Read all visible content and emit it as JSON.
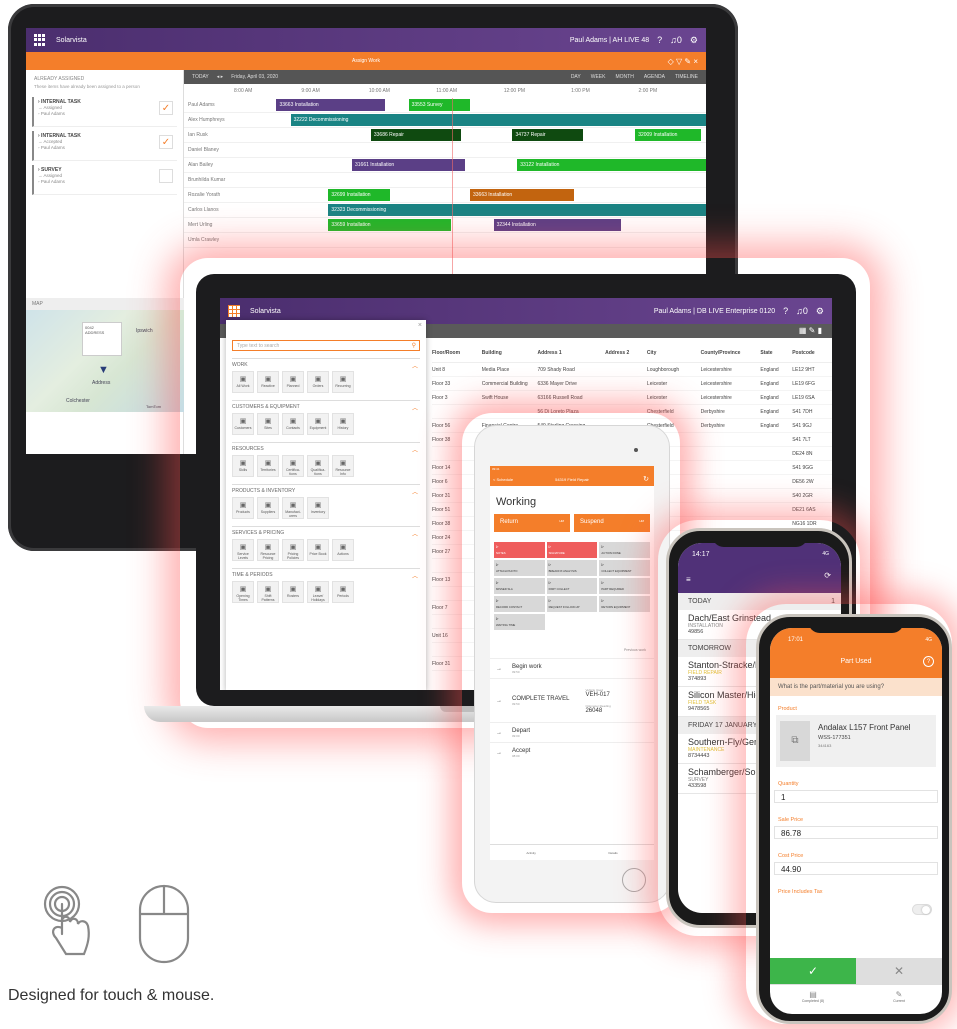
{
  "monitor": {
    "app_name": "Solarvista",
    "user": "Paul Adams | AH LIVE 48",
    "icons": [
      "help-icon",
      "bell-icon",
      "gear-icon"
    ],
    "notif_count": "0",
    "orange_title": "Assign Work",
    "left": {
      "title": "ALREADY ASSIGNED",
      "subtitle": "These items have already been assigned to a person",
      "tasks": [
        {
          "name": "INTERNAL TASK",
          "status": "Assigned",
          "person": "Paul Adams",
          "checked": true
        },
        {
          "name": "INTERNAL TASK",
          "status": "Accepted",
          "person": "Paul Adams",
          "checked": true
        },
        {
          "name": "SURVEY",
          "status": "Assigned",
          "person": "Paul Adams",
          "checked": false
        }
      ],
      "map_label": "MAP",
      "map_popup": [
        "0042",
        "ADDRESS"
      ],
      "map_places": [
        "Ipswich",
        "Address",
        "Colchester"
      ],
      "map_credit": "TomTom"
    },
    "calendar": {
      "today": "TODAY",
      "date": "Friday, April 03, 2020",
      "views": [
        "DAY",
        "WEEK",
        "MONTH",
        "AGENDA",
        "TIMELINE"
      ],
      "times": [
        "8:00 AM",
        "9:00 AM",
        "10:00 AM",
        "11:00 AM",
        "12:00 PM",
        "1:00 PM",
        "2:00 PM"
      ],
      "rows": [
        {
          "name": "Paul Adams",
          "bars": [
            {
              "label": "33663 Installation",
              "c": "purple",
              "s": 0.09,
              "w": 0.23
            },
            {
              "label": "33553 Survey",
              "c": "green",
              "s": 0.37,
              "w": 0.13
            }
          ]
        },
        {
          "name": "Alex Humphreys",
          "bars": [
            {
              "label": "32222 Decommissioning",
              "c": "teal",
              "s": 0.12,
              "w": 0.88
            }
          ]
        },
        {
          "name": "Ian Rusk",
          "bars": [
            {
              "label": "33686 Repair",
              "c": "dkgreen",
              "s": 0.29,
              "w": 0.19
            },
            {
              "label": "34737 Repair",
              "c": "dkgreen",
              "s": 0.59,
              "w": 0.15
            },
            {
              "label": "32009 Installation",
              "c": "green",
              "s": 0.85,
              "w": 0.14
            }
          ]
        },
        {
          "name": "Daniel Blaney",
          "bars": []
        },
        {
          "name": "Alan Bailey",
          "bars": [
            {
              "label": "31661 Installation",
              "c": "purple",
              "s": 0.25,
              "w": 0.24
            },
            {
              "label": "33122 Installation",
              "c": "green",
              "s": 0.6,
              "w": 0.4
            }
          ]
        },
        {
          "name": "Brunhilda Kumar",
          "bars": []
        },
        {
          "name": "Rozalie Yorath",
          "bars": [
            {
              "label": "32699 Installation",
              "c": "green",
              "s": 0.2,
              "w": 0.13
            },
            {
              "label": "33663 Installation",
              "c": "orange",
              "s": 0.5,
              "w": 0.22
            }
          ]
        },
        {
          "name": "Carlos Llanos",
          "bars": [
            {
              "label": "32323 Decommissioning",
              "c": "teal",
              "s": 0.2,
              "w": 0.8
            }
          ]
        },
        {
          "name": "Mert Urling",
          "bars": [
            {
              "label": "33659 Installation",
              "c": "green",
              "s": 0.2,
              "w": 0.26
            },
            {
              "label": "32344 Installation",
              "c": "purple",
              "s": 0.55,
              "w": 0.27
            }
          ]
        },
        {
          "name": "Umla Crawley",
          "bars": []
        }
      ]
    }
  },
  "laptop": {
    "app_name": "Solarvista",
    "user": "Paul Adams | DB LIVE Enterprise 0120",
    "search_placeholder": "Type text to search",
    "sections": [
      {
        "title": "WORK",
        "tiles": [
          [
            "All Work",
            "clipboard-icon"
          ],
          [
            "Reactive",
            "wrench-icon"
          ],
          [
            "Planned",
            "bell-icon"
          ],
          [
            "Orders",
            "org-icon"
          ],
          [
            "Recurring",
            "shield-icon"
          ]
        ]
      },
      {
        "title": "CUSTOMERS & EQUIPMENT",
        "tiles": [
          [
            "Customers",
            "building-icon"
          ],
          [
            "Sites",
            "globe-icon"
          ],
          [
            "Contacts",
            "people-icon"
          ],
          [
            "Equipment",
            "doc-icon"
          ],
          [
            "History",
            "history-icon"
          ]
        ]
      },
      {
        "title": "RESOURCES",
        "tiles": [
          [
            "Skills",
            "person-icon"
          ],
          [
            "Territories",
            "map-icon"
          ],
          [
            "Certifica-tions",
            "cert-icon"
          ],
          [
            "Qualifica-tions",
            "qual-icon"
          ],
          [
            "Resource Info",
            "card-icon"
          ]
        ]
      },
      {
        "title": "PRODUCTS & INVENTORY",
        "tiles": [
          [
            "Products",
            "box-icon"
          ],
          [
            "Suppliers",
            "cart-icon"
          ],
          [
            "Manufact-urers",
            "factory-icon"
          ],
          [
            "Inventory",
            "list-icon"
          ]
        ]
      },
      {
        "title": "SERVICES & PRICING",
        "tiles": [
          [
            "Service Levels",
            "timer-icon"
          ],
          [
            "Resource Pricing",
            "price-icon"
          ],
          [
            "Pricing Policies",
            "policy-icon"
          ],
          [
            "Price Book",
            "tag-icon"
          ],
          [
            "Actions",
            "hand-icon"
          ]
        ]
      },
      {
        "title": "TIME & PERIODS",
        "tiles": [
          [
            "Opening Times",
            "shop-icon"
          ],
          [
            "Shift Patterns",
            "clock-icon"
          ],
          [
            "Rosters",
            "bed-icon"
          ],
          [
            "Leave/ Holidays",
            "plane-icon"
          ],
          [
            "Periods",
            "calendar-icon"
          ]
        ]
      }
    ],
    "table": {
      "headers": [
        "Floor/Room",
        "Building",
        "Address 1",
        "Address 2",
        "City",
        "County/Province",
        "State",
        "Postcode"
      ],
      "rows": [
        [
          "Unit 8",
          "Media Place",
          "709 Shady Road",
          "",
          "Loughborough",
          "Leicestershire",
          "England",
          "LE12 9HT"
        ],
        [
          "Floor 33",
          "Commercial Building",
          "6336 Mayer Drive",
          "",
          "Leicester",
          "Leicestershire",
          "England",
          "LE19 6FG"
        ],
        [
          "Floor 3",
          "Swift House",
          "63166 Russell Road",
          "",
          "Leicester",
          "Leicestershire",
          "England",
          "LE19 6SA"
        ],
        [
          "",
          "",
          "56 Di Loreto Plaza",
          "",
          "Chesterfield",
          "Derbyshire",
          "England",
          "S41 7DH"
        ],
        [
          "Floor 56",
          "Financial Centre",
          "549 Sterling Crossing",
          "",
          "Chesterfield",
          "Derbyshire",
          "England",
          "S41 9GJ"
        ],
        [
          "Floor 38",
          "",
          "",
          "",
          "",
          "",
          "",
          "S41 7LT"
        ],
        [
          "",
          "",
          "",
          "",
          "",
          "",
          "",
          "DE24 8N"
        ],
        [
          "Floor 14",
          "",
          "",
          "",
          "",
          "",
          "",
          "S41 9GG"
        ],
        [
          "Floor 6",
          "",
          "",
          "",
          "",
          "",
          "",
          "DE56 2W"
        ],
        [
          "Floor 31",
          "",
          "",
          "",
          "",
          "",
          "",
          "S40 2GR"
        ],
        [
          "Floor 51",
          "",
          "",
          "",
          "",
          "",
          "",
          "DE21 6AS"
        ],
        [
          "Floor 38",
          "",
          "",
          "",
          "",
          "",
          "",
          "NG16 1DR"
        ],
        [
          "Floor 24",
          "",
          "",
          "",
          "",
          "",
          "",
          "NG16 7TA"
        ],
        [
          "Floor 27",
          "",
          "",
          "",
          "",
          "",
          "",
          ""
        ],
        [
          "",
          "",
          "",
          "",
          "",
          "",
          "",
          ""
        ],
        [
          "Floor 13",
          "",
          "",
          "",
          "",
          "",
          "",
          ""
        ],
        [
          "",
          "",
          "",
          "",
          "",
          "",
          "",
          ""
        ],
        [
          "Floor 7",
          "",
          "",
          "",
          "",
          "",
          "",
          ""
        ],
        [
          "",
          "",
          "",
          "",
          "",
          "",
          "",
          ""
        ],
        [
          "Unit 16",
          "",
          "",
          "",
          "",
          "",
          "",
          ""
        ],
        [
          "",
          "",
          "",
          "",
          "",
          "",
          "",
          ""
        ],
        [
          "Floor 31",
          "",
          "",
          "",
          "",
          "",
          "",
          ""
        ]
      ]
    }
  },
  "tablet": {
    "status_time": "09:41",
    "back": "< Schedule",
    "header": "54319 Field Repair",
    "title": "Working",
    "buttons": [
      {
        "label": "Return",
        "sub": "HM"
      },
      {
        "label": "Suspend",
        "sub": "HM"
      }
    ],
    "actions": [
      {
        "label": "NOTES",
        "red": true
      },
      {
        "label": "SIGNATURE",
        "red": true
      },
      {
        "label": "ACTION DONE",
        "red": false
      },
      {
        "label": "ATTACH PHOTO",
        "red": false
      },
      {
        "label": "BREAKFIX ANALYSIS",
        "red": false
      },
      {
        "label": "COLLECT EQUIPMENT",
        "red": false
      },
      {
        "label": "MISSED SLA",
        "red": false
      },
      {
        "label": "PART COLLECT",
        "red": false
      },
      {
        "label": "PART REQUIRED",
        "red": false
      },
      {
        "label": "RECORD CONTACT",
        "red": false
      },
      {
        "label": "REQUEST FOLLOW-UP",
        "red": false
      },
      {
        "label": "RETURN EQUIPMENT",
        "red": false
      },
      {
        "label": "WAITING TIME",
        "red": false
      }
    ],
    "previous": "Previous work",
    "timeline": [
      {
        "label": "Begin work",
        "time": "09:50"
      },
      {
        "label": "COMPLETE TRAVEL",
        "time": "09:50",
        "vehicle_label": "Vehicle Used",
        "vehicle": "VEH-017",
        "odo_label": "Odometer Reading",
        "odo": "26048"
      },
      {
        "label": "Depart",
        "time": "09:00"
      },
      {
        "label": "Accept",
        "time": "08:00"
      }
    ],
    "tabs": [
      "Activity",
      "Details"
    ]
  },
  "phone1": {
    "time": "14:17",
    "status": "4G",
    "today": "TODAY",
    "today_count": "1",
    "tomorrow": "TOMORROW",
    "friday": "FRIDAY 17 JANUARY",
    "jobs": [
      {
        "title": "Dach/East Grinstead",
        "type": "INSTALLATION",
        "id": "49856",
        "yellow": false
      },
      {
        "title": "Stanton-Stracke/Hig",
        "type": "FIELD REPAIR",
        "id": "374893",
        "yellow": true
      },
      {
        "title": "Silicon Master/High",
        "type": "FIELD TASK",
        "id": "9478565",
        "yellow": true
      },
      {
        "title": "Southern-Fly/Gerra",
        "type": "MAINTENANCE",
        "id": "8734443",
        "yellow": true
      },
      {
        "title": "Schamberger/South",
        "type": "SURVEY",
        "id": "433598",
        "yellow": false
      }
    ]
  },
  "phone2": {
    "time": "17:01",
    "status": "4G",
    "title": "Part Used",
    "question": "What is the part/material you are using?",
    "product_label": "Product",
    "product_name": "Andalax L157 Front Panel",
    "product_code": "WSS-177351",
    "product_sub": "344163",
    "quantity_label": "Quantity",
    "quantity": "1",
    "sale_label": "Sale Price",
    "sale": "86.78",
    "cost_label": "Cost Price",
    "cost": "44.90",
    "tax_label": "Price Includes Tax",
    "footer": [
      "Completed (8)",
      "Current"
    ]
  },
  "tagline": "Designed for touch & mouse."
}
